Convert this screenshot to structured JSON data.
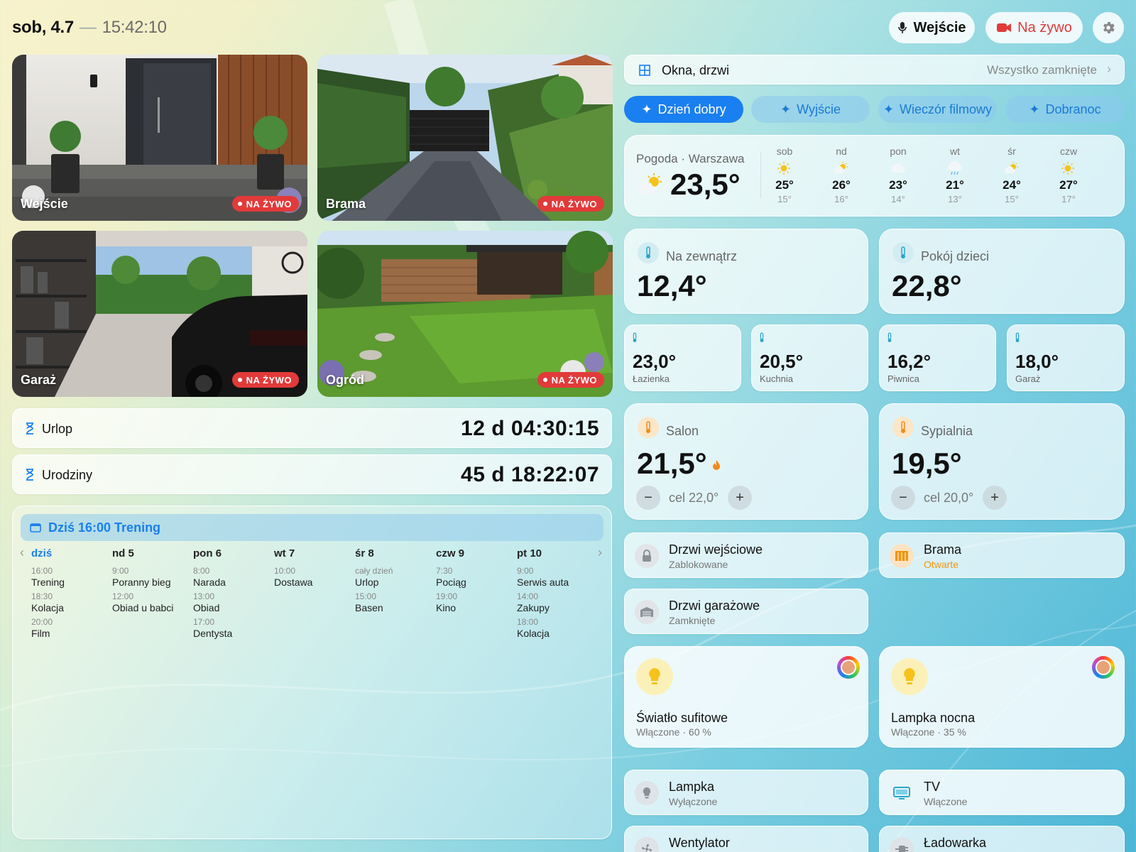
{
  "header": {
    "date": "sob, 4.7",
    "separator": "—",
    "time": "15:42:10",
    "entrance_button": "Wejście",
    "live_button": "Na żywo"
  },
  "cameras": [
    {
      "label": "Wejście",
      "badge": "NA ŻYWO"
    },
    {
      "label": "Brama",
      "badge": "NA ŻYWO"
    },
    {
      "label": "Garaż",
      "badge": "NA ŻYWO"
    },
    {
      "label": "Ogród",
      "badge": "NA ŻYWO"
    }
  ],
  "countdowns": [
    {
      "name": "Urlop",
      "value": "12 d 04:30:15"
    },
    {
      "name": "Urodziny",
      "value": "45 d 18:22:07"
    }
  ],
  "calendar": {
    "banner": "Dziś 16:00 Trening",
    "days": [
      {
        "label": "dziś",
        "events": [
          {
            "time": "16:00",
            "name": "Trening"
          },
          {
            "time": "18:30",
            "name": "Kolacja"
          },
          {
            "time": "20:00",
            "name": "Film"
          }
        ]
      },
      {
        "label": "nd 5",
        "events": [
          {
            "time": "9:00",
            "name": "Poranny bieg"
          },
          {
            "time": "12:00",
            "name": "Obiad u babci"
          }
        ]
      },
      {
        "label": "pon 6",
        "events": [
          {
            "time": "8:00",
            "name": "Narada"
          },
          {
            "time": "13:00",
            "name": "Obiad"
          },
          {
            "time": "17:00",
            "name": "Dentysta"
          }
        ]
      },
      {
        "label": "wt 7",
        "events": [
          {
            "time": "10:00",
            "name": "Dostawa"
          }
        ]
      },
      {
        "label": "śr 8",
        "events": [
          {
            "time": "cały dzień",
            "name": "Urlop"
          },
          {
            "time": "15:00",
            "name": "Basen"
          }
        ]
      },
      {
        "label": "czw 9",
        "events": [
          {
            "time": "7:30",
            "name": "Pociąg"
          },
          {
            "time": "19:00",
            "name": "Kino"
          }
        ]
      },
      {
        "label": "pt 10",
        "events": [
          {
            "time": "9:00",
            "name": "Serwis auta"
          },
          {
            "time": "14:00",
            "name": "Zakupy"
          },
          {
            "time": "18:00",
            "name": "Kolacja"
          }
        ]
      }
    ]
  },
  "windows": {
    "label": "Okna, drzwi",
    "status": "Wszystko zamknięte"
  },
  "scenes": [
    "Dzień dobry",
    "Wyjście",
    "Wieczór filmowy",
    "Dobranoc"
  ],
  "weather": {
    "title": "Pogoda · Warszawa",
    "current": "23,5°",
    "forecast": [
      {
        "day": "sob",
        "icon": "sun-icon",
        "hi": "25°",
        "lo": "15°"
      },
      {
        "day": "nd",
        "icon": "partly-sunny-icon",
        "hi": "26°",
        "lo": "16°"
      },
      {
        "day": "pon",
        "icon": "cloud-icon",
        "hi": "23°",
        "lo": "14°"
      },
      {
        "day": "wt",
        "icon": "rain-icon",
        "hi": "21°",
        "lo": "13°"
      },
      {
        "day": "śr",
        "icon": "partly-sunny-icon",
        "hi": "24°",
        "lo": "15°"
      },
      {
        "day": "czw",
        "icon": "sun-icon",
        "hi": "27°",
        "lo": "17°"
      }
    ]
  },
  "temps": {
    "outside": {
      "name": "Na zewnątrz",
      "value": "12,4°"
    },
    "kids": {
      "name": "Pokój dzieci",
      "value": "22,8°"
    },
    "small": [
      {
        "value": "23,0°",
        "name": "Łazienka"
      },
      {
        "value": "20,5°",
        "name": "Kuchnia"
      },
      {
        "value": "16,2°",
        "name": "Piwnica"
      },
      {
        "value": "18,0°",
        "name": "Garaż"
      }
    ]
  },
  "thermostats": [
    {
      "name": "Salon",
      "value": "21,5°",
      "target": "cel 22,0°",
      "minus": "−",
      "plus": "+"
    },
    {
      "name": "Sypialnia",
      "value": "19,5°",
      "target": "cel 20,0°",
      "minus": "−",
      "plus": "+"
    }
  ],
  "devices": {
    "front_door": {
      "name": "Drzwi wejściowe",
      "state": "Zablokowane"
    },
    "gate": {
      "name": "Brama",
      "state": "Otwarte"
    },
    "garage_door": {
      "name": "Drzwi garażowe",
      "state": "Zamknięte"
    },
    "ceiling_light": {
      "name": "Światło sufitowe",
      "state": "Włączone · 60 %"
    },
    "night_lamp": {
      "name": "Lampka nocna",
      "state": "Włączone · 35 %"
    },
    "lamp": {
      "name": "Lampka",
      "state": "Wyłączone"
    },
    "tv": {
      "name": "TV",
      "state": "Włączone"
    },
    "fan": {
      "name": "Wentylator"
    },
    "charger": {
      "name": "Ładowarka"
    }
  },
  "colors": {
    "accent": "#1a7ff0",
    "live": "#e23a3a",
    "warm": "#f28a1a",
    "gate_open": "#f0960f"
  }
}
